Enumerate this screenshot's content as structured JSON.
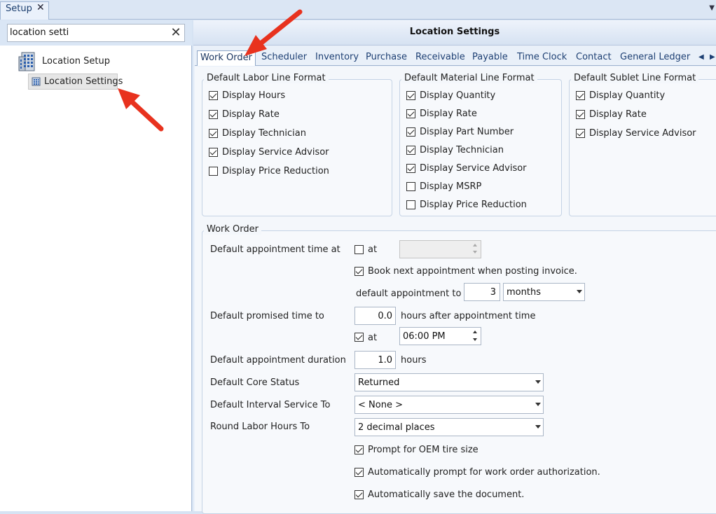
{
  "topbar": {
    "tab_label": "Setup",
    "tab_close": "✕",
    "menu_glyph": "▼"
  },
  "search": {
    "value": "location setti",
    "clear_glyph": "✕"
  },
  "tree": {
    "root_label": "Location Setup",
    "child_label": "Location Settings"
  },
  "panel": {
    "title": "Location Settings"
  },
  "tabs": [
    "Work Order",
    "Scheduler",
    "Inventory",
    "Purchase",
    "Receivable",
    "Payable",
    "Time Clock",
    "Contact",
    "General Ledger"
  ],
  "tab_scroll": {
    "left": "◀",
    "right": "▶"
  },
  "labor": {
    "title": "Default Labor Line Format",
    "items": [
      {
        "label": "Display Hours",
        "checked": true
      },
      {
        "label": "Display Rate",
        "checked": true
      },
      {
        "label": "Display Technician",
        "checked": true
      },
      {
        "label": "Display Service Advisor",
        "checked": true
      },
      {
        "label": "Display Price Reduction",
        "checked": false
      }
    ]
  },
  "material": {
    "title": "Default Material Line Format",
    "items": [
      {
        "label": "Display Quantity",
        "checked": true
      },
      {
        "label": "Display Rate",
        "checked": true
      },
      {
        "label": "Display Part Number",
        "checked": true
      },
      {
        "label": "Display Technician",
        "checked": true
      },
      {
        "label": "Display Service Advisor",
        "checked": true
      },
      {
        "label": "Display MSRP",
        "checked": false
      },
      {
        "label": "Display Price Reduction",
        "checked": false
      }
    ]
  },
  "sublet": {
    "title": "Default Sublet Line Format",
    "items": [
      {
        "label": "Display Quantity",
        "checked": true
      },
      {
        "label": "Display Rate",
        "checked": true
      },
      {
        "label": "Display Service Advisor",
        "checked": true
      }
    ]
  },
  "work_order": {
    "title": "Work Order",
    "appt_time_label": "Default appointment time at",
    "appt_at_label": "at",
    "book_next_label": "Book next appointment when posting invoice.",
    "default_appt_to_label": "default appointment to",
    "default_appt_to_value": "3",
    "default_appt_to_unit": "months",
    "promised_label": "Default promised time to",
    "promised_value": "0.0",
    "promised_suffix": "hours after appointment time",
    "promised_at_label": "at",
    "promised_at_time": "06:00 PM",
    "duration_label": "Default appointment duration",
    "duration_value": "1.0",
    "duration_suffix": "hours",
    "core_status_label": "Default Core Status",
    "core_status_value": "Returned",
    "interval_label": "Default Interval Service To",
    "interval_value": "< None >",
    "round_label": "Round Labor Hours To",
    "round_value": "2 decimal places",
    "oem_label": "Prompt for OEM tire size",
    "auth_label": "Automatically prompt for work order authorization.",
    "save_label": "Automatically save the document."
  },
  "colors": {
    "annotation_arrow": "#e8321e"
  }
}
